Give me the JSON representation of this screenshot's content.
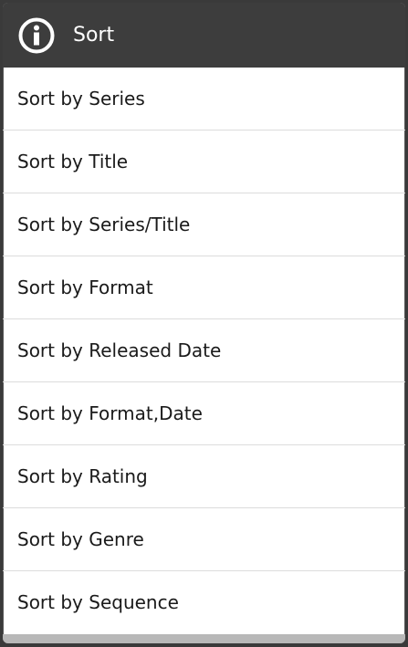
{
  "dialog": {
    "title": "Sort",
    "title_icon": "info-icon",
    "options": [
      {
        "label": "Sort by Series"
      },
      {
        "label": "Sort by Title"
      },
      {
        "label": "Sort by Series/Title"
      },
      {
        "label": "Sort by Format"
      },
      {
        "label": "Sort by Released Date"
      },
      {
        "label": "Sort by Format,Date"
      },
      {
        "label": "Sort by Rating"
      },
      {
        "label": "Sort by Genre"
      },
      {
        "label": "Sort by Sequence"
      }
    ]
  },
  "colors": {
    "title_bar": "#3d3d3d",
    "list_background": "#ffffff",
    "divider": "#dcdcdc",
    "text": "#1a1a1a"
  }
}
